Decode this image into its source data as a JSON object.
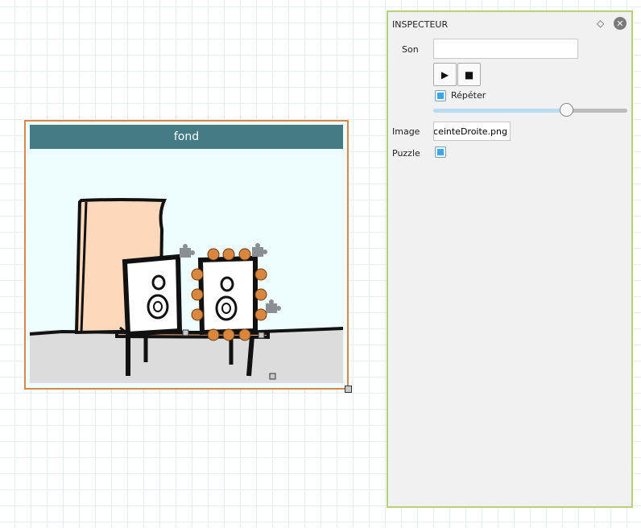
{
  "scene": {
    "title": "fond"
  },
  "inspector": {
    "title": "INSPECTEUR",
    "sound_label": "Son",
    "sound_value": "",
    "play_icon": "play-icon",
    "stop_icon": "stop-icon",
    "repeat_label": "Répéter",
    "repeat_checked": true,
    "volume": 0.7,
    "image_label": "Image",
    "image_value": "EnceinteDroite.png",
    "puzzle_label": "Puzzle",
    "puzzle_checked": true
  },
  "colors": {
    "header": "#447b84",
    "frame": "#d6884f",
    "inspector_border": "#b5d27a",
    "checkbox": "#3ba5ea",
    "selection_handles": "#d9873e"
  }
}
